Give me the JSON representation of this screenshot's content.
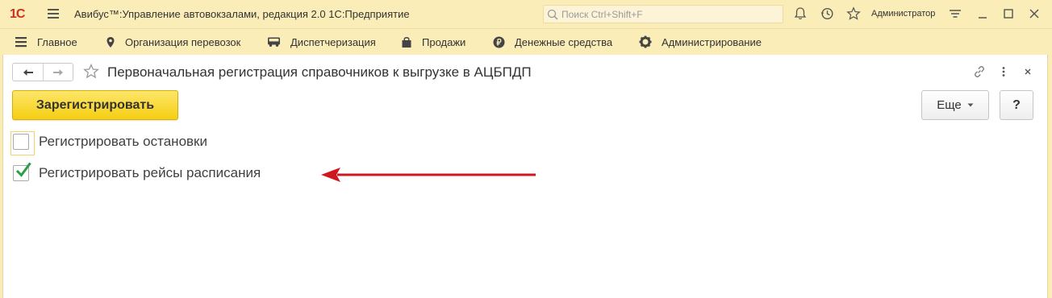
{
  "app": {
    "title": "Авибус™:Управление автовокзалами, редакция 2.0 1С:Предприятие",
    "logo_text": "1С",
    "search_placeholder": "Поиск Ctrl+Shift+F",
    "user": "Администратор",
    "icons": [
      "menu-icon",
      "search-icon",
      "bell-icon",
      "history-icon",
      "star-icon",
      "settings-icon",
      "minimize-icon",
      "maximize-icon",
      "close-icon"
    ]
  },
  "sections": [
    {
      "label": "Главное",
      "icon": "menu-icon"
    },
    {
      "label": "Организация перевозок",
      "icon": "location-pin-icon"
    },
    {
      "label": "Диспетчеризация",
      "icon": "bus-icon"
    },
    {
      "label": "Продажи",
      "icon": "shopping-bag-icon"
    },
    {
      "label": "Денежные средства",
      "icon": "ruble-icon"
    },
    {
      "label": "Администрирование",
      "icon": "gear-icon"
    }
  ],
  "form": {
    "title": "Первоначальная регистрация справочников к выгрузке в АЦБПДП",
    "register_button": "Зарегистрировать",
    "more_button": "Еще",
    "help_button": "?",
    "checkboxes": [
      {
        "label": "Регистрировать остановки",
        "checked": false
      },
      {
        "label": "Регистрировать рейсы расписания",
        "checked": true
      }
    ]
  },
  "colors": {
    "chrome_background": "#fbedb8",
    "primary_button": "#f5cf12",
    "check_mark": "#2a9d47",
    "annotation_arrow": "#d0161e",
    "logo": "#d02f20"
  }
}
